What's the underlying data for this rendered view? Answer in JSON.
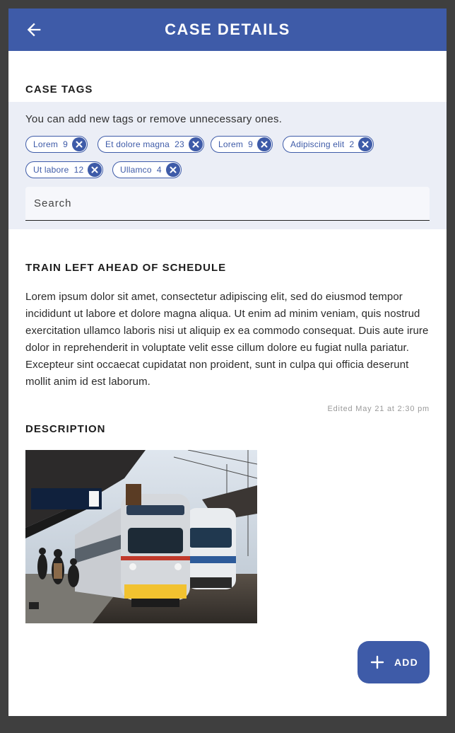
{
  "appbar": {
    "title": "CASE DETAILS",
    "back_icon": "arrow-left-icon",
    "color": "#3e5ba8"
  },
  "tags": {
    "section_title": "CASE TAGS",
    "hint": "You can add new tags or remove unnecessary ones.",
    "items": [
      {
        "label": "Lorem",
        "count": "9"
      },
      {
        "label": "Et dolore magna",
        "count": "23"
      },
      {
        "label": "Lorem",
        "count": "9"
      },
      {
        "label": "Adipiscing elit",
        "count": "2"
      },
      {
        "label": "Ut labore",
        "count": "12"
      },
      {
        "label": "Ullamco",
        "count": "4"
      }
    ],
    "remove_icon": "close-circle-icon",
    "search_placeholder": "Search"
  },
  "article": {
    "title": "TRAIN LEFT AHEAD OF SCHEDULE",
    "body": "Lorem ipsum dolor sit amet, consectetur adipiscing elit, sed do eiusmod tempor incididunt ut labore et dolore magna aliqua. Ut enim ad minim veniam, quis nostrud exercitation ullamco laboris nisi ut aliquip ex ea commodo consequat. Duis aute irure dolor in reprehenderit in voluptate velit esse cillum dolore eu fugiat nulla pariatur. Excepteur sint occaecat cupidatat non proident, sunt in culpa qui officia deserunt mollit anim id est laborum.",
    "edited": "Edited May 21 at 2:30 pm"
  },
  "description": {
    "section_title": "DESCRIPTION",
    "photo": "train-station-photo"
  },
  "fab": {
    "label": "ADD",
    "icon": "plus-icon"
  }
}
